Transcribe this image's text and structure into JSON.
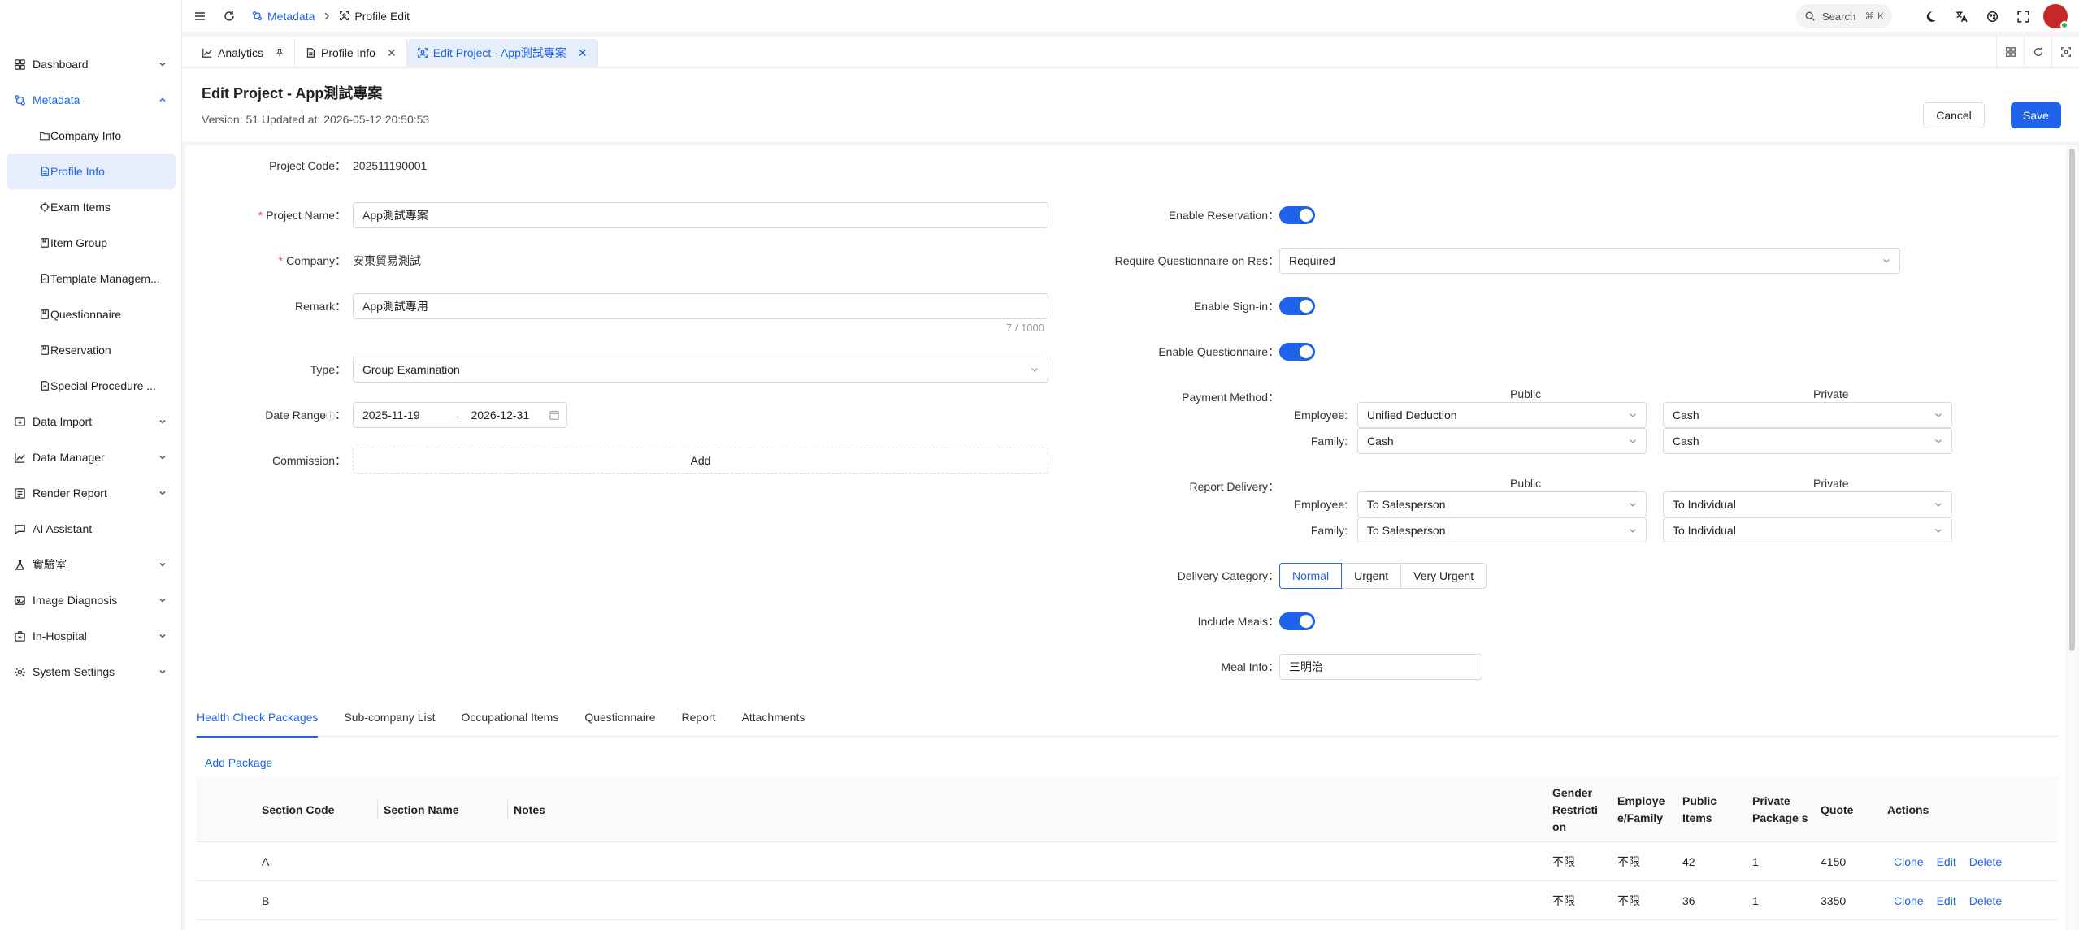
{
  "colors": {
    "accent": "#1e63e9",
    "required": "#ff4d4f",
    "selected_bg": "#e6eefc"
  },
  "sidebar": {
    "items": [
      {
        "label": "Dashboard",
        "icon": "dashboard-icon",
        "expandable": true
      },
      {
        "label": "Metadata",
        "icon": "metadata-icon",
        "expandable": true,
        "expanded": true
      },
      {
        "label": "Data Import",
        "icon": "import-icon",
        "expandable": true
      },
      {
        "label": "Data Manager",
        "icon": "chart-icon",
        "expandable": true
      },
      {
        "label": "Render Report",
        "icon": "report-icon",
        "expandable": true
      },
      {
        "label": "AI Assistant",
        "icon": "chat-icon",
        "expandable": false
      },
      {
        "label": "實驗室",
        "icon": "flask-icon",
        "expandable": true
      },
      {
        "label": "Image Diagnosis",
        "icon": "image-icon",
        "expandable": true
      },
      {
        "label": "In-Hospital",
        "icon": "hospital-icon",
        "expandable": true
      },
      {
        "label": "System Settings",
        "icon": "gear-icon",
        "expandable": true
      }
    ],
    "sub_items": [
      {
        "label": "Company Info",
        "icon": "folder-icon"
      },
      {
        "label": "Profile Info",
        "icon": "document-icon",
        "selected": true
      },
      {
        "label": "Exam Items",
        "icon": "target-icon"
      },
      {
        "label": "Item Group",
        "icon": "book-icon"
      },
      {
        "label": "Template Managem...",
        "icon": "template-icon"
      },
      {
        "label": "Questionnaire",
        "icon": "book-icon"
      },
      {
        "label": "Reservation",
        "icon": "book-icon"
      },
      {
        "label": "Special Procedure ...",
        "icon": "template-icon"
      }
    ]
  },
  "topbar": {
    "breadcrumb_parent": "Metadata",
    "breadcrumb_current": "Profile Edit",
    "search_placeholder": "Search",
    "search_shortcut": "⌘ K"
  },
  "tabs": [
    {
      "label": "Analytics",
      "pinned": true
    },
    {
      "label": "Profile Info",
      "closable": true
    },
    {
      "label": "Edit Project - App測試專案",
      "closable": true,
      "active": true
    }
  ],
  "header": {
    "title": "Edit Project - App測試專案",
    "meta": "Version: 51 Updated at: 2026-05-12 20:50:53",
    "cancel_label": "Cancel",
    "save_label": "Save"
  },
  "form_left": {
    "project_code_label": "Project Code",
    "project_code": "202511190001",
    "project_name_label": "Project Name",
    "project_name": "App測試專案",
    "company_label": "Company",
    "company": "安東貿易測試",
    "remark_label": "Remark",
    "remark": "App測試專用",
    "remark_counter": "7 / 1000",
    "type_label": "Type",
    "type": "Group Examination",
    "date_range_label": "Date Range",
    "date_start": "2025-11-19",
    "date_end": "2026-12-31",
    "commission_label": "Commission",
    "commission_add": "Add"
  },
  "form_right": {
    "enable_reservation_label": "Enable Reservation",
    "enable_reservation": true,
    "require_questionnaire_label": "Require Questionnaire on Res",
    "require_questionnaire": "Required",
    "enable_signin_label": "Enable Sign-in",
    "enable_signin": true,
    "enable_questionnaire_label": "Enable Questionnaire",
    "enable_questionnaire": true,
    "payment_method_label": "Payment Method",
    "col_public": "Public",
    "col_private": "Private",
    "employee_label": "Employee:",
    "family_label": "Family:",
    "payment": {
      "employee_public": "Unified Deduction",
      "employee_private": "Cash",
      "family_public": "Cash",
      "family_private": "Cash"
    },
    "report_delivery_label": "Report Delivery",
    "delivery": {
      "employee_public": "To Salesperson",
      "employee_private": "To Individual",
      "family_public": "To Salesperson",
      "family_private": "To Individual"
    },
    "delivery_category_label": "Delivery Category",
    "delivery_categories": [
      "Normal",
      "Urgent",
      "Very Urgent"
    ],
    "delivery_category_selected": "Normal",
    "include_meals_label": "Include Meals",
    "include_meals": true,
    "meal_info_label": "Meal Info",
    "meal_info": "三明治"
  },
  "lower_tabs": [
    "Health Check Packages",
    "Sub-company List",
    "Occupational Items",
    "Questionnaire",
    "Report",
    "Attachments"
  ],
  "add_package_label": "Add Package",
  "table": {
    "headers": {
      "section_code": "Section Code",
      "section_name": "Section Name",
      "notes": "Notes",
      "gender": "Gender Restricti on",
      "employee_family": "Employe e/Family",
      "public_items": "Public Items",
      "private_packages": "Private Package s",
      "quote": "Quote",
      "actions": "Actions"
    },
    "rows": [
      {
        "code": "A",
        "name": "",
        "notes": "",
        "gender": "不限",
        "ef": "不限",
        "public_items": "42",
        "private_packages": "1",
        "quote": "4150"
      },
      {
        "code": "B",
        "name": "",
        "notes": "",
        "gender": "不限",
        "ef": "不限",
        "public_items": "36",
        "private_packages": "1",
        "quote": "3350"
      }
    ],
    "actions": {
      "clone": "Clone",
      "edit": "Edit",
      "delete": "Delete"
    }
  }
}
